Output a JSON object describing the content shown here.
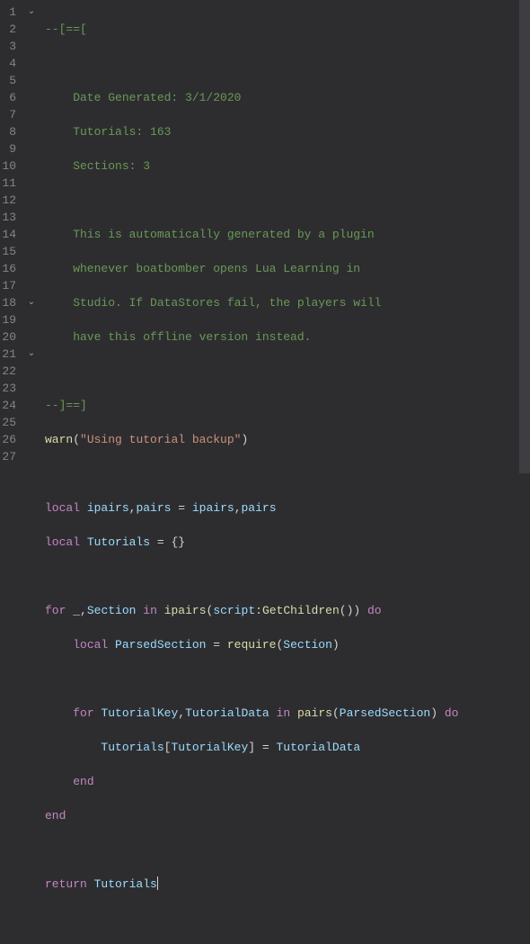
{
  "gutter": {
    "lines": [
      "1",
      "2",
      "3",
      "4",
      "5",
      "6",
      "7",
      "8",
      "9",
      "10",
      "11",
      "12",
      "13",
      "14",
      "15",
      "16",
      "17",
      "18",
      "19",
      "20",
      "21",
      "22",
      "23",
      "24",
      "25",
      "26",
      "27"
    ]
  },
  "folds": {
    "l1": "⌄",
    "l18": "⌄",
    "l21": "⌄"
  },
  "code": {
    "l1": "--[==[",
    "l3": "    Date Generated: 3/1/2020",
    "l4": "    Tutorials: 163",
    "l5": "    Sections: 3",
    "l7": "    This is automatically generated by a plugin",
    "l8": "    whenever boatbomber opens Lua Learning in",
    "l9": "    Studio. If DataStores fail, the players will",
    "l10": "    have this offline version instead.",
    "l12": "--]==]",
    "l13": {
      "fn": "warn",
      "paren_o": "(",
      "str": "\"Using tutorial backup\"",
      "paren_c": ")"
    },
    "l15": {
      "kw": "local",
      "sp": " ",
      "id1": "ipairs",
      "c1": ",",
      "id2": "pairs",
      "eq": " = ",
      "id3": "ipairs",
      "c2": ",",
      "id4": "pairs"
    },
    "l16": {
      "kw": "local",
      "sp": " ",
      "id": "Tutorials",
      "eq": " = ",
      "b": "{}"
    },
    "l18": {
      "kw1": "for",
      "sp1": " ",
      "u": "_",
      "c": ",",
      "id1": "Section",
      "sp2": " ",
      "kw2": "in",
      "sp3": " ",
      "fn": "ipairs",
      "po": "(",
      "id2": "script",
      "col": ":",
      "meth": "GetChildren",
      "pc": "())",
      "sp4": " ",
      "kw3": "do"
    },
    "l19": {
      "ind": "    ",
      "kw": "local",
      "sp": " ",
      "id1": "ParsedSection",
      "eq": " = ",
      "fn": "require",
      "po": "(",
      "id2": "Section",
      "pc": ")"
    },
    "l21": {
      "ind": "    ",
      "kw1": "for",
      "sp1": " ",
      "id1": "TutorialKey",
      "c": ",",
      "id2": "TutorialData",
      "sp2": " ",
      "kw2": "in",
      "sp3": " ",
      "fn": "pairs",
      "po": "(",
      "id3": "ParsedSection",
      "pc": ")",
      "sp4": " ",
      "kw3": "do"
    },
    "l22": {
      "ind": "        ",
      "id1": "Tutorials",
      "b1": "[",
      "id2": "TutorialKey",
      "b2": "]",
      "eq": " = ",
      "id3": "TutorialData"
    },
    "l23": {
      "ind": "    ",
      "kw": "end"
    },
    "l24": {
      "kw": "end"
    },
    "l26": {
      "kw": "return",
      "sp": " ",
      "id": "Tutorials"
    }
  }
}
